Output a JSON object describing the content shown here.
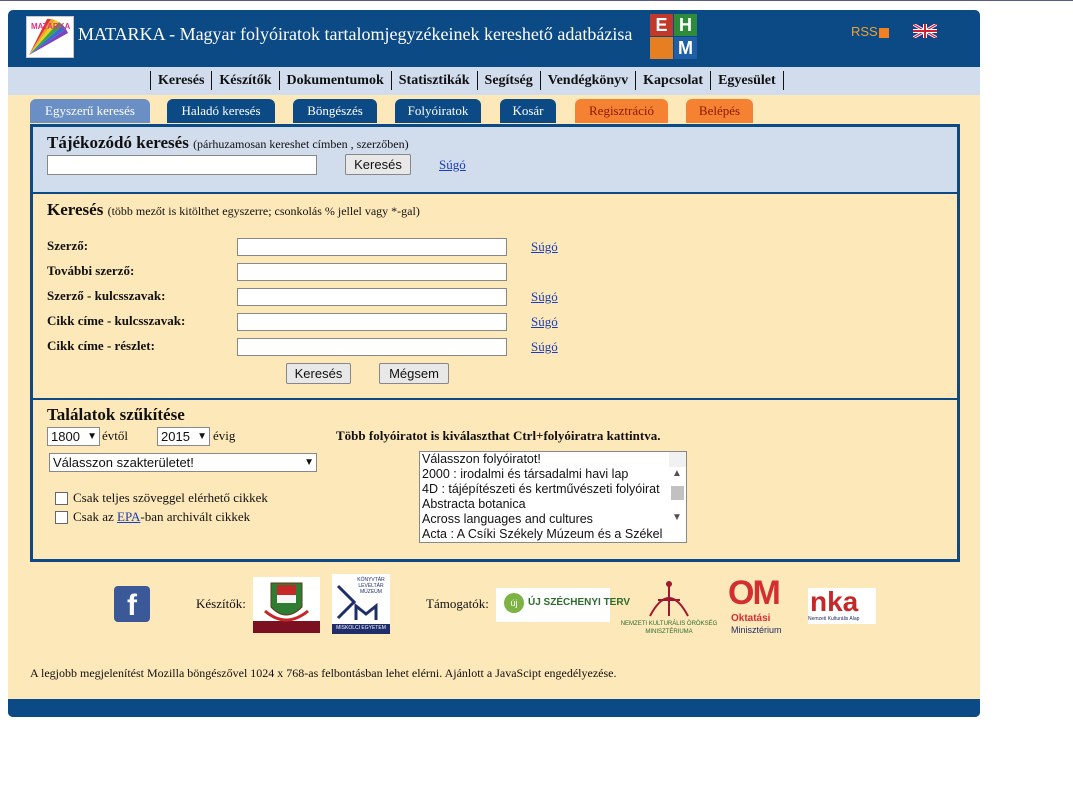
{
  "header": {
    "site_title": "MATARKA - Magyar folyóiratok tartalomjegyzékeinek kereshető adatbázisa",
    "logo_text": "MATARKA",
    "ehm_letters": [
      "E",
      "H",
      "M"
    ],
    "rss_label": "RSS",
    "colors": {
      "frame": "#0b4a85",
      "content_bg": "#fde8b9",
      "menu_bg": "#d1dced",
      "orange_tab": "#f58233"
    }
  },
  "menu": {
    "items": [
      "Keresés",
      "Készítők",
      "Dokumentumok",
      "Statisztikák",
      "Segítség",
      "Vendégkönyv",
      "Kapcsolat",
      "Egyesület"
    ]
  },
  "tabs": [
    "Egyszerű keresés",
    "Haladó keresés",
    "Böngészés",
    "Folyóiratok",
    "Kosár",
    "Regisztráció",
    "Belépés"
  ],
  "quick_search": {
    "title": "Tájékozódó keresés",
    "subtitle": "(párhuzamosan kereshet címben , szerzőben)",
    "input_value": "",
    "button_label": "Keresés",
    "help_link": "Súgó"
  },
  "search": {
    "title": "Keresés",
    "subtitle": "(több mezőt is kitölthet egyszerre; csonkolás % jellel vagy *-gal)",
    "fields": [
      {
        "label": "Szerző:",
        "value": "",
        "help": "Súgó"
      },
      {
        "label": "További szerző:",
        "value": "",
        "help": ""
      },
      {
        "label": "Szerző - kulcsszavak:",
        "value": "",
        "help": "Súgó"
      },
      {
        "label": "Cikk címe - kulcsszavak:",
        "value": "",
        "help": "Súgó"
      },
      {
        "label": "Cikk címe - részlet:",
        "value": "",
        "help": "Súgó"
      }
    ],
    "search_button": "Keresés",
    "cancel_button": "Mégsem"
  },
  "filter": {
    "title": "Találatok szűkítése",
    "year_from": "1800",
    "year_from_suffix": "évtől",
    "year_to": "2015",
    "year_to_suffix": "évig",
    "field_select": "Válasszon szakterületet!",
    "multi_hint": "Több folyóiratot is kiválaszthat Ctrl+folyóiratra kattintva.",
    "checkbox_fulltext": "Csak teljes szöveggel elérhető cikkek",
    "checkbox_epa_prefix": "Csak az",
    "checkbox_epa_link": "EPA",
    "checkbox_epa_suffix": "-ban archivált cikkek",
    "journals": [
      "Válasszon folyóiratot!",
      "2000 : irodalmi és társadalmi havi lap",
      "4D : tájépítészeti és kertművészeti folyóirat",
      "Abstracta botanica",
      "Across languages and cultures",
      "Acta : A Csíki Székely Múzeum és a Székel"
    ]
  },
  "footer": {
    "makers_label": "Készítők:",
    "supporters_label": "Támogatók:",
    "facebook_letter": "f",
    "library_logo_text": "KÖNYVTÁR LEVÉLTÁR MÚZEUM",
    "library_logo_sub": "MISKOLCI EGYETEM",
    "szechenyi": "ÚJ SZÉCHENYI TERV",
    "szechenyi_badge": "új",
    "nko_text": "NEMZETI KULTURÁLIS ÖRÖKSÉG MINISZTÉRIUMA",
    "om_letters": "OM",
    "om_line1": "Oktatási",
    "om_line2": "Minisztérium",
    "nka": "nka",
    "nka_sub": "Nemzeti Kulturális Alap",
    "note": "A legjobb megjelenítést Mozilla böngészővel 1024 x 768-as felbontásban lehet elérni. Ajánlott a JavaScipt engedélyezése."
  }
}
